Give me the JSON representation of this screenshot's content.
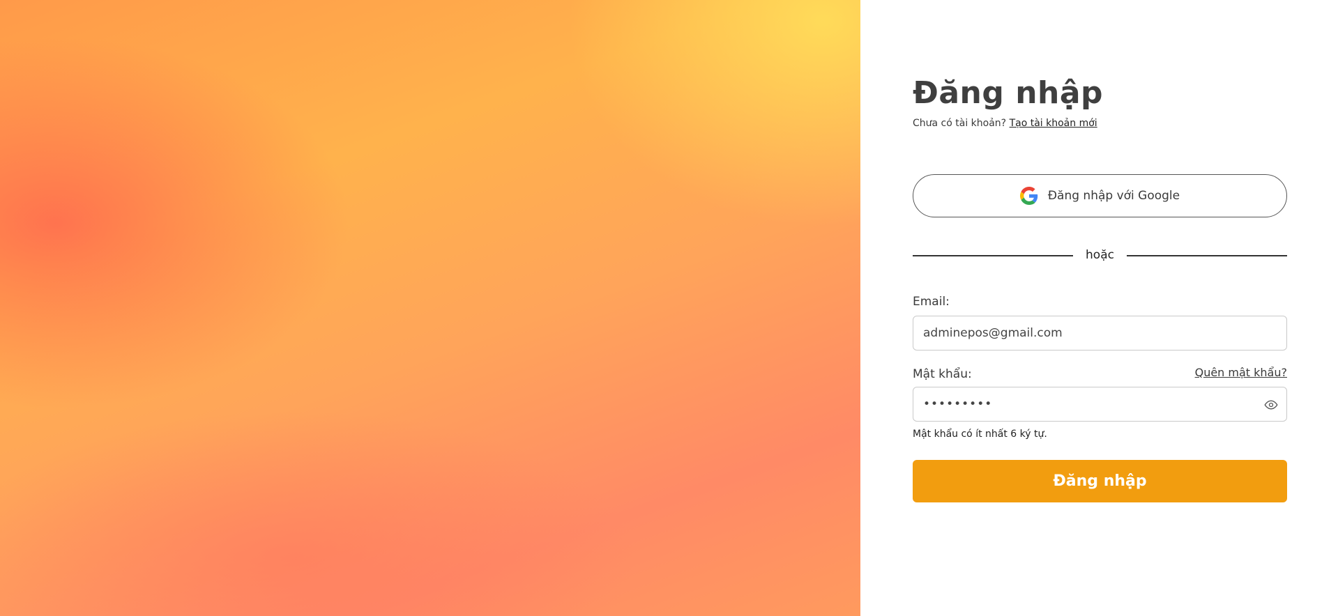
{
  "login": {
    "title": "Đăng nhập",
    "subtitle_prefix": "Chưa có tài khoản?",
    "create_account_link": "Tạo tài khoản mới",
    "google_button": "Đăng nhập với Google",
    "divider_text": "hoặc",
    "email_label": "Email:",
    "email_value": "adminepos@gmail.com",
    "password_label": "Mật khẩu:",
    "forgot_link": "Quên mật khẩu?",
    "password_value": "•••••••••",
    "password_hint": "Mật khẩu có ít nhất 6 ký tự.",
    "submit_button": "Đăng nhập"
  },
  "colors": {
    "accent": "#f29d0f",
    "hero_top": "#ffd95a",
    "hero_left": "#ff6a58"
  },
  "icons": {
    "google": "google-icon",
    "eye": "eye-icon"
  }
}
